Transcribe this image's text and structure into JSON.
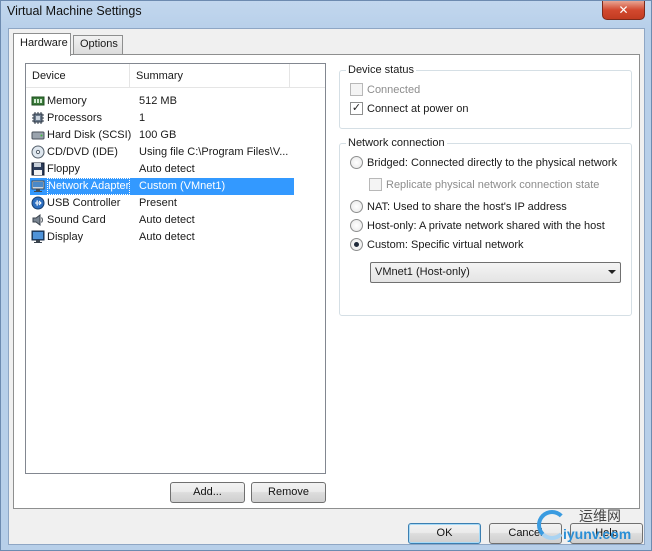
{
  "window": {
    "title": "Virtual Machine Settings",
    "close_label": "✕"
  },
  "tabs": [
    {
      "label": "Hardware",
      "active": true
    },
    {
      "label": "Options",
      "active": false
    }
  ],
  "device_list": {
    "columns": [
      "Device",
      "Summary"
    ],
    "rows": [
      {
        "icon": "memory-icon",
        "device": "Memory",
        "summary": "512 MB",
        "selected": false
      },
      {
        "icon": "processor-icon",
        "device": "Processors",
        "summary": "1",
        "selected": false
      },
      {
        "icon": "hard-disk-icon",
        "device": "Hard Disk (SCSI)",
        "summary": "100 GB",
        "selected": false
      },
      {
        "icon": "cd-dvd-icon",
        "device": "CD/DVD (IDE)",
        "summary": "Using file C:\\Program Files\\V...",
        "selected": false
      },
      {
        "icon": "floppy-icon",
        "device": "Floppy",
        "summary": "Auto detect",
        "selected": false
      },
      {
        "icon": "network-adapter-icon",
        "device": "Network Adapter",
        "summary": "Custom (VMnet1)",
        "selected": true
      },
      {
        "icon": "usb-icon",
        "device": "USB Controller",
        "summary": "Present",
        "selected": false
      },
      {
        "icon": "sound-card-icon",
        "device": "Sound Card",
        "summary": "Auto detect",
        "selected": false
      },
      {
        "icon": "display-icon",
        "device": "Display",
        "summary": "Auto detect",
        "selected": false
      }
    ]
  },
  "list_buttons": {
    "add": "Add...",
    "remove": "Remove"
  },
  "device_status": {
    "title": "Device status",
    "connected": {
      "label": "Connected",
      "checked": false,
      "enabled": false
    },
    "connect_at_power_on": {
      "label": "Connect at power on",
      "checked": true,
      "enabled": true
    }
  },
  "network_connection": {
    "title": "Network connection",
    "bridged": {
      "label": "Bridged: Connected directly to the physical network",
      "selected": false
    },
    "replicate": {
      "label": "Replicate physical network connection state",
      "checked": false,
      "enabled": false
    },
    "nat": {
      "label": "NAT: Used to share the host's IP address",
      "selected": false
    },
    "host_only": {
      "label": "Host-only: A private network shared with the host",
      "selected": false
    },
    "custom": {
      "label": "Custom: Specific virtual network",
      "selected": true
    },
    "vmnet_select": {
      "value": "VMnet1 (Host-only)"
    }
  },
  "dialog_buttons": {
    "ok": "OK",
    "cancel": "Cancel",
    "help": "Help"
  },
  "watermark": {
    "cn": "运维网",
    "en": "iyunv.com"
  },
  "colors": {
    "selection": "#3399ff",
    "title_bar": "#b9d1ea",
    "close_button": "#c23b21"
  }
}
